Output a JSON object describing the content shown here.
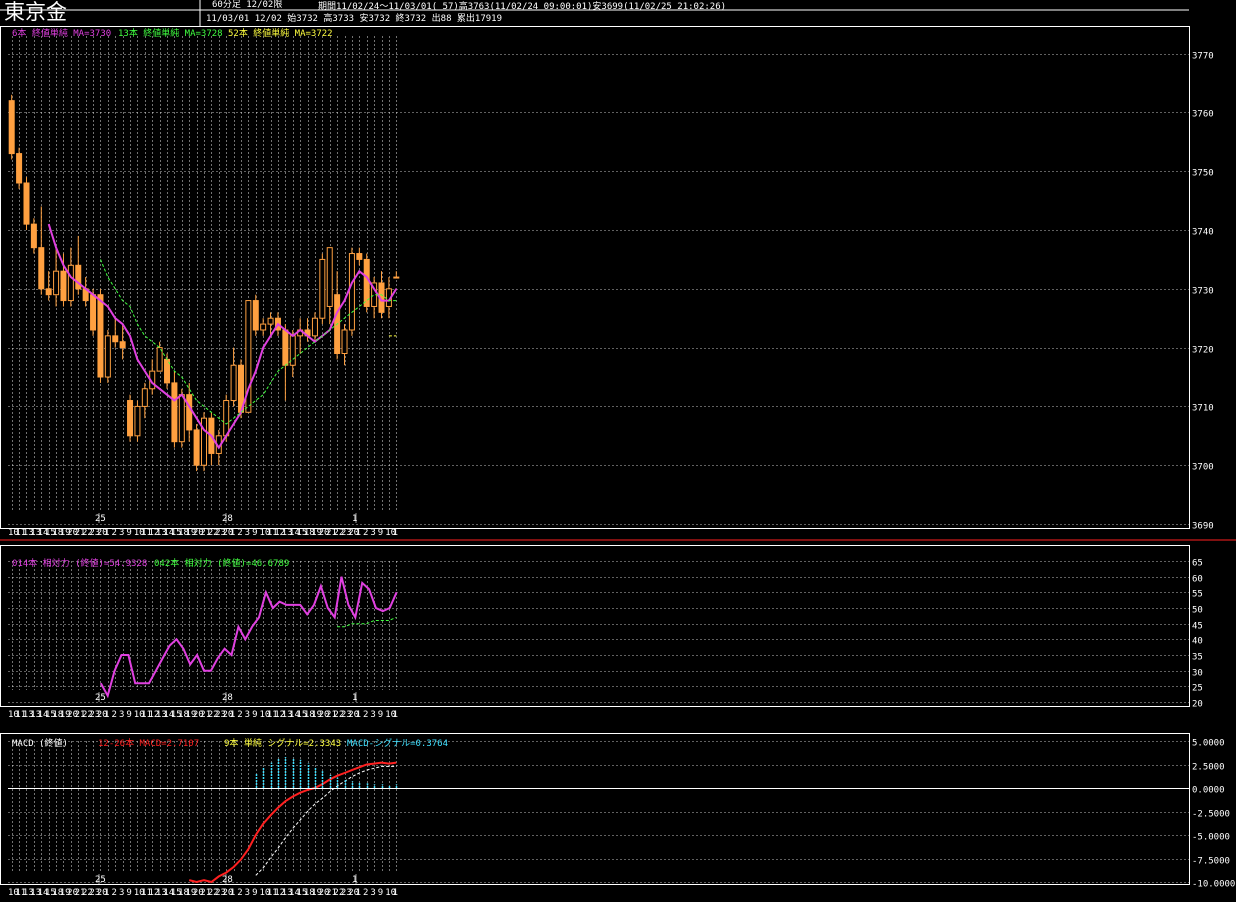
{
  "header": {
    "title": "東京金",
    "period_label": "60分足  12/02限",
    "range_line": "期間11/02/24～11/03/01( 57)高3763(11/02/24 09:00:01)安3699(11/02/25 21:02:26)",
    "bar_line": "11/03/01 12/02 始3732 高3733 安3732 終3732 出88 累出17919"
  },
  "colors": {
    "up": "#ffa040",
    "down": "#ffa040",
    "ma6": "#e040e0",
    "ma13": "#40ff40",
    "ma52": "#ffff40",
    "macd": "#ff2020",
    "signal": "#ffffff",
    "histogram": "#40e0ff",
    "grid": "#ffffff"
  },
  "x_axis": {
    "labels": [
      "10",
      "11",
      "13",
      "13",
      "14",
      "15",
      "18",
      "19",
      "20",
      "21",
      "22",
      "23",
      "20",
      "1",
      "2",
      "3",
      "9",
      "10",
      "11",
      "12",
      "13",
      "14",
      "15",
      "18",
      "19",
      "20",
      "21",
      "22",
      "23",
      "20",
      "1",
      "2",
      "3",
      "9",
      "10",
      "11",
      "12",
      "13",
      "14",
      "15",
      "18",
      "19",
      "20",
      "21",
      "22",
      "23",
      "20",
      "1",
      "2",
      "3",
      "9",
      "10",
      "1"
    ],
    "day_marks": [
      "25",
      "28",
      "1"
    ]
  },
  "chart_data": [
    {
      "type": "candlestick",
      "legend": [
        "6本 終値単純 MA=3730",
        "13本 終値単純 MA=3728",
        "52本 終値単純 MA=3722"
      ],
      "y_ticks": [
        3690,
        3700,
        3710,
        3720,
        3730,
        3740,
        3750,
        3760,
        3770
      ],
      "ylim": [
        3690,
        3773
      ],
      "grid": true,
      "candles": [
        [
          3762,
          3763,
          3752,
          3753
        ],
        [
          3753,
          3754,
          3747,
          3748
        ],
        [
          3748,
          3749,
          3740,
          3741
        ],
        [
          3741,
          3742,
          3736,
          3737
        ],
        [
          3737,
          3744,
          3729,
          3730
        ],
        [
          3730,
          3733,
          3728,
          3729
        ],
        [
          3729,
          3737,
          3727,
          3733
        ],
        [
          3733,
          3736,
          3727,
          3728
        ],
        [
          3728,
          3737,
          3727,
          3734
        ],
        [
          3734,
          3739,
          3729,
          3730
        ],
        [
          3730,
          3732,
          3727,
          3728
        ],
        [
          3729,
          3730,
          3722,
          3723
        ],
        [
          3729,
          3730,
          3714,
          3715
        ],
        [
          3715,
          3723,
          3714,
          3722
        ],
        [
          3722,
          3725,
          3720,
          3721
        ],
        [
          3721,
          3724,
          3718,
          3720
        ],
        [
          3711,
          3712,
          3704,
          3705
        ],
        [
          3705,
          3711,
          3704,
          3710
        ],
        [
          3710,
          3714,
          3708,
          3713
        ],
        [
          3713,
          3718,
          3712,
          3716
        ],
        [
          3716,
          3721,
          3716,
          3720
        ],
        [
          3718,
          3719,
          3713,
          3714
        ],
        [
          3714,
          3716,
          3703,
          3704
        ],
        [
          3704,
          3713,
          3703,
          3712
        ],
        [
          3712,
          3714,
          3704,
          3706
        ],
        [
          3706,
          3707,
          3699,
          3700
        ],
        [
          3700,
          3709,
          3699,
          3708
        ],
        [
          3708,
          3709,
          3700,
          3702
        ],
        [
          3702,
          3706,
          3700,
          3705
        ],
        [
          3705,
          3712,
          3704,
          3711
        ],
        [
          3711,
          3720,
          3710,
          3717
        ],
        [
          3717,
          3718,
          3708,
          3709
        ],
        [
          3709,
          3728,
          3709,
          3728
        ],
        [
          3728,
          3729,
          3722,
          3723
        ],
        [
          3723,
          3725,
          3722,
          3724
        ],
        [
          3724,
          3726,
          3722,
          3725
        ],
        [
          3725,
          3726,
          3722,
          3723
        ],
        [
          3723,
          3724,
          3711,
          3717
        ],
        [
          3717,
          3723,
          3715,
          3722
        ],
        [
          3722,
          3725,
          3719,
          3723
        ],
        [
          3723,
          3725,
          3721,
          3722
        ],
        [
          3722,
          3726,
          3721,
          3725
        ],
        [
          3725,
          3736,
          3724,
          3735
        ],
        [
          3727,
          3737,
          3724,
          3737
        ],
        [
          3729,
          3733,
          3718,
          3719
        ],
        [
          3719,
          3724,
          3717,
          3723
        ],
        [
          3723,
          3737,
          3722,
          3736
        ],
        [
          3736,
          3737,
          3734,
          3735
        ],
        [
          3735,
          3736,
          3726,
          3727
        ],
        [
          3727,
          3732,
          3725,
          3731
        ],
        [
          3731,
          3733,
          3725,
          3726
        ],
        [
          3727,
          3732,
          3725,
          3730
        ],
        [
          3732,
          3733,
          3732,
          3732
        ]
      ],
      "series": [
        {
          "name": "6本 終値単純",
          "values": [
            null,
            null,
            null,
            null,
            null,
            3741,
            3737,
            3734,
            3732,
            3731,
            3730,
            3729,
            3728,
            3727,
            3725,
            3724,
            3722,
            3718,
            3716,
            3714,
            3713,
            3712,
            3711,
            3712,
            3710,
            3708,
            3706,
            3705,
            3703,
            3705,
            3707,
            3709,
            3713,
            3716,
            3720,
            3722,
            3724,
            3723,
            3722,
            3723,
            3722,
            3721,
            3722,
            3723,
            3726,
            3728,
            3731,
            3733,
            3732,
            3730,
            3728,
            3728,
            3730
          ]
        },
        {
          "name": "13本 終値単純",
          "values": [
            null,
            null,
            null,
            null,
            null,
            null,
            null,
            null,
            null,
            null,
            null,
            null,
            3735,
            3732,
            3730,
            3728,
            3727,
            3724,
            3722,
            3721,
            3720,
            3718,
            3716,
            3715,
            3713,
            3711,
            3710,
            3709,
            3708,
            3707,
            3708,
            3709,
            3710,
            3711,
            3712,
            3714,
            3716,
            3717,
            3718,
            3719,
            3720,
            3721,
            3722,
            3723,
            3724,
            3725,
            3726,
            3727,
            3728,
            3729,
            3729,
            3728,
            3728
          ]
        },
        {
          "name": "52本 終値単純",
          "values": [
            null,
            null,
            null,
            null,
            null,
            null,
            null,
            null,
            null,
            null,
            null,
            null,
            null,
            null,
            null,
            null,
            null,
            null,
            null,
            null,
            null,
            null,
            null,
            null,
            null,
            null,
            null,
            null,
            null,
            null,
            null,
            null,
            null,
            null,
            null,
            null,
            null,
            null,
            null,
            null,
            null,
            null,
            null,
            null,
            null,
            null,
            null,
            null,
            null,
            null,
            null,
            3722,
            3722
          ]
        }
      ]
    },
    {
      "type": "line",
      "legend": [
        "014本 相対力 (終値)=54.9328",
        "042本 相対力 (終値)=46.6789"
      ],
      "y_ticks": [
        20,
        25,
        30,
        35,
        40,
        45,
        50,
        55,
        60,
        65
      ],
      "ylim": [
        20,
        65
      ],
      "grid": true,
      "series": [
        {
          "name": "014本 相対力 (終値)",
          "values": [
            null,
            null,
            null,
            null,
            null,
            null,
            null,
            null,
            null,
            null,
            null,
            null,
            null,
            26,
            22,
            30,
            35,
            35,
            26,
            26,
            26,
            30,
            34,
            38,
            40,
            37,
            32,
            35,
            30,
            30,
            34,
            37,
            35,
            44,
            40,
            44,
            47,
            55,
            50,
            52,
            51,
            51,
            51,
            48,
            51,
            57,
            50,
            47,
            60,
            51,
            47,
            58,
            56,
            50,
            49,
            50,
            55
          ]
        },
        {
          "name": "042本 相対力 (終値)",
          "values": [
            null,
            null,
            null,
            null,
            null,
            null,
            null,
            null,
            null,
            null,
            null,
            null,
            null,
            null,
            null,
            null,
            null,
            null,
            null,
            null,
            null,
            null,
            null,
            null,
            null,
            null,
            null,
            null,
            null,
            null,
            null,
            null,
            null,
            null,
            null,
            null,
            null,
            null,
            null,
            null,
            null,
            null,
            null,
            null,
            44,
            44,
            45,
            45,
            45,
            46,
            46,
            46,
            47
          ]
        }
      ]
    },
    {
      "type": "line",
      "legend": [
        "MACD (終値)",
        "12-26本 MACD=2.7107",
        "9本 単純 シグナル=2.3343",
        "MACD-シグナル=0.3764"
      ],
      "y_ticks": [
        -10,
        -7.5,
        -5,
        -2.5,
        0,
        2.5,
        5
      ],
      "y_tick_labels": [
        "-10.0000",
        "-7.5000",
        "-5.0000",
        "-2.5000",
        "0.0000",
        "2.5000",
        "5.0000"
      ],
      "ylim": [
        -10,
        5
      ],
      "grid": true,
      "series": [
        {
          "name": "MACD",
          "values": [
            null,
            null,
            null,
            null,
            null,
            null,
            null,
            null,
            null,
            null,
            null,
            null,
            null,
            null,
            null,
            null,
            null,
            null,
            null,
            null,
            null,
            null,
            null,
            null,
            -9.8,
            -10,
            -9.8,
            -10,
            -9.4,
            -9,
            -8.4,
            -7.6,
            -6.5,
            -5,
            -3.8,
            -2.9,
            -2.1,
            -1.4,
            -0.9,
            -0.5,
            -0.2,
            0.0,
            0.4,
            0.9,
            1.3,
            1.6,
            1.9,
            2.2,
            2.5,
            2.6,
            2.7,
            2.6,
            2.7
          ]
        },
        {
          "name": "シグナル",
          "values": [
            null,
            null,
            null,
            null,
            null,
            null,
            null,
            null,
            null,
            null,
            null,
            null,
            null,
            null,
            null,
            null,
            null,
            null,
            null,
            null,
            null,
            null,
            null,
            null,
            null,
            null,
            null,
            null,
            null,
            null,
            null,
            null,
            null,
            -9.3,
            -8.5,
            -7.4,
            -6.4,
            -5.3,
            -4.3,
            -3.4,
            -2.5,
            -1.7,
            -1.1,
            -0.4,
            0.2,
            0.7,
            1.2,
            1.6,
            1.9,
            2.1,
            2.3,
            2.3,
            2.3
          ]
        },
        {
          "name": "MACD-シグナル",
          "values": [
            null,
            null,
            null,
            null,
            null,
            null,
            null,
            null,
            null,
            null,
            null,
            null,
            null,
            null,
            null,
            null,
            null,
            null,
            null,
            null,
            null,
            null,
            null,
            null,
            null,
            null,
            null,
            null,
            null,
            null,
            null,
            null,
            null,
            1.6,
            2.2,
            2.7,
            3.1,
            3.3,
            3.2,
            3.0,
            2.6,
            2.2,
            1.8,
            1.4,
            1.1,
            0.9,
            0.7,
            0.6,
            0.5,
            0.4,
            0.4,
            0.3,
            0.4
          ]
        }
      ]
    }
  ]
}
